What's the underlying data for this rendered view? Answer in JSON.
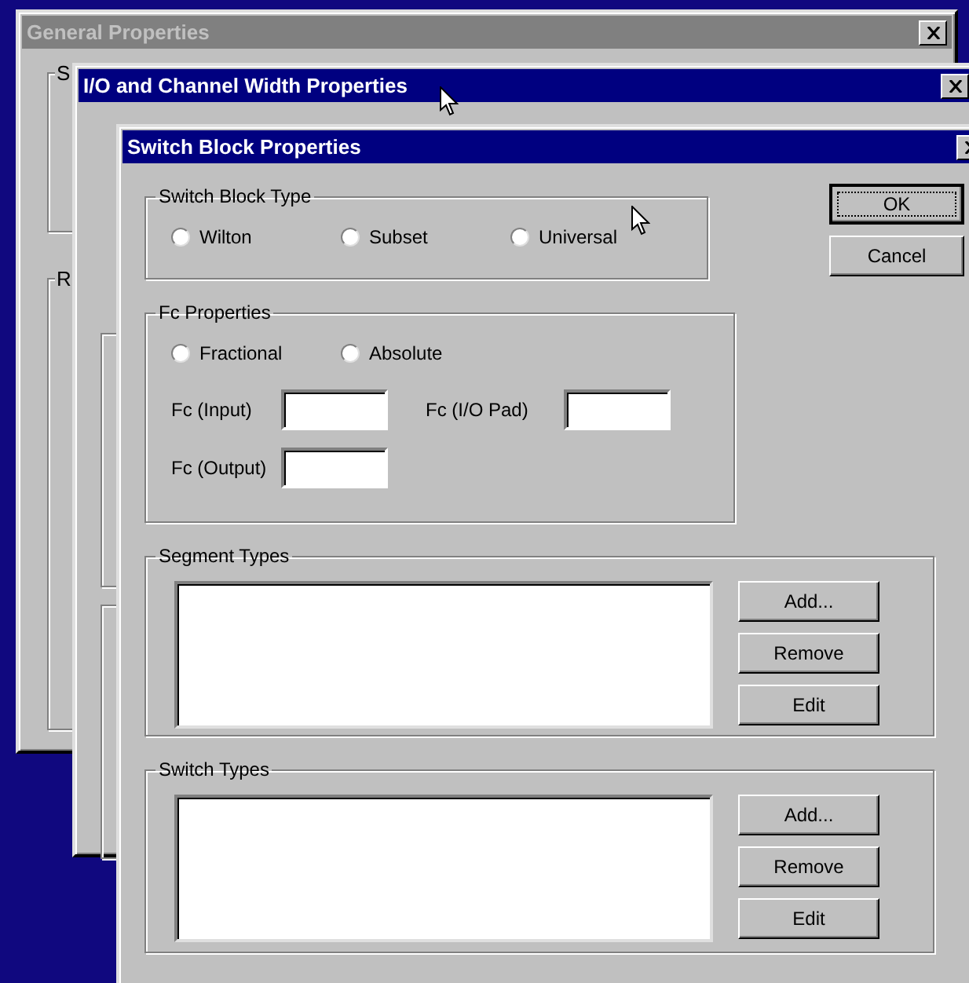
{
  "windows": [
    {
      "title": "General Properties",
      "active": false,
      "groups": [
        "S",
        "R"
      ]
    },
    {
      "title": "I/O and Channel Width Properties",
      "active": true
    },
    {
      "title": "Switch Block Properties",
      "active": true
    }
  ],
  "switch_block_type": {
    "label": "Switch Block Type",
    "options": [
      {
        "label": "Wilton",
        "selected": false
      },
      {
        "label": "Subset",
        "selected": false
      },
      {
        "label": "Universal",
        "selected": false
      }
    ]
  },
  "fc_properties": {
    "label": "Fc Properties",
    "options": [
      {
        "label": "Fractional",
        "selected": false
      },
      {
        "label": "Absolute",
        "selected": false
      }
    ],
    "fields": [
      {
        "label": "Fc (Input)"
      },
      {
        "label": "Fc (I/O Pad)"
      },
      {
        "label": "Fc (Output)"
      }
    ]
  },
  "dialog_buttons": [
    {
      "label": "OK",
      "default": true
    },
    {
      "label": "Cancel",
      "default": false
    }
  ],
  "lists": [
    {
      "label": "Segment Types",
      "buttons": [
        "Add...",
        "Remove",
        "Edit"
      ]
    },
    {
      "label": "Switch Types",
      "buttons": [
        "Add...",
        "Remove",
        "Edit"
      ]
    }
  ]
}
